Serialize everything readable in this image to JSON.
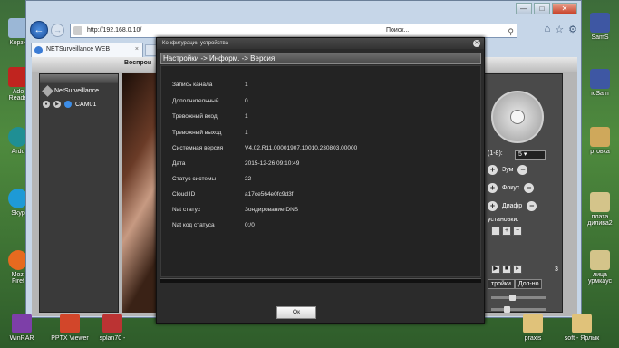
{
  "desktop": {
    "left_icons": [
      {
        "label": "Корзи",
        "color": "#9bb7d6"
      },
      {
        "label": "Ado",
        "label2": "Reade",
        "color": "#c0241f"
      },
      {
        "label": "Ardu",
        "color": "#1f8f94"
      },
      {
        "label": "Skyp",
        "color": "#1e9ad6"
      },
      {
        "label": "Mozi",
        "label2": "Firef",
        "color": "#e66a1f"
      }
    ],
    "right_icons": [
      {
        "label": "SamS",
        "color": "#3e57a3"
      },
      {
        "label": "icSam",
        "color": "#3e57a3"
      },
      {
        "label": "ртовка",
        "color": "#cfa85b"
      },
      {
        "label": "плата",
        "label2": "дилива2",
        "color": "#d4c48a"
      },
      {
        "label": "лица",
        "label2": "урмкаус",
        "color": "#d4c48a"
      }
    ],
    "taskbar": [
      {
        "label": "WinRAR",
        "color": "#7d3fa8"
      },
      {
        "label": "PPTX Viewer",
        "color": "#d2462a"
      },
      {
        "label": "splan70 -",
        "color": "#b33"
      },
      {
        "label": "praxis",
        "color": "#e0c27a"
      },
      {
        "label": "soft - Ярлык",
        "color": "#e0c27a"
      }
    ]
  },
  "browser": {
    "address": "http://192.168.0.10/",
    "search_placeholder": "Поиск...",
    "tab_title": "NETSurveillance WEB",
    "caption": {
      "min": "—",
      "max": "□",
      "close": "✕"
    }
  },
  "webapp": {
    "top_label": "Воспрои",
    "tree_root": "NetSurveillance",
    "camera": "CAM01",
    "ptz": {
      "speed_label": "(1-8):",
      "speed_value": "5",
      "zoom": "Зум",
      "focus": "Фокус",
      "iris": "Диафр",
      "presets": "установки:",
      "tab_a": "тройки",
      "tab_b": "Доп-но",
      "side_number": "3"
    }
  },
  "dialog": {
    "title": "Конфигурации устройства",
    "breadcrumb": "Настройки -> Информ. -> Версия",
    "rows": [
      {
        "key": "Запись канала",
        "value": "1"
      },
      {
        "key": "Дополнительный",
        "value": "0"
      },
      {
        "key": "Тревожный вход",
        "value": "1"
      },
      {
        "key": "Тревожный выход",
        "value": "1"
      },
      {
        "key": "Системная версия",
        "value": "V4.02.R11.00001907.10010.230803.00000"
      },
      {
        "key": "Дата",
        "value": "2015-12-26 09:10:49"
      },
      {
        "key": "Статус системы",
        "value": "22"
      },
      {
        "key": "Cloud ID",
        "value": "a17ce564e0fc9d3f"
      },
      {
        "key": "Nat статус",
        "value": "Зондирование DNS"
      },
      {
        "key": "Nat код статуса",
        "value": "0:/0"
      }
    ],
    "ok_label": "Ок"
  }
}
